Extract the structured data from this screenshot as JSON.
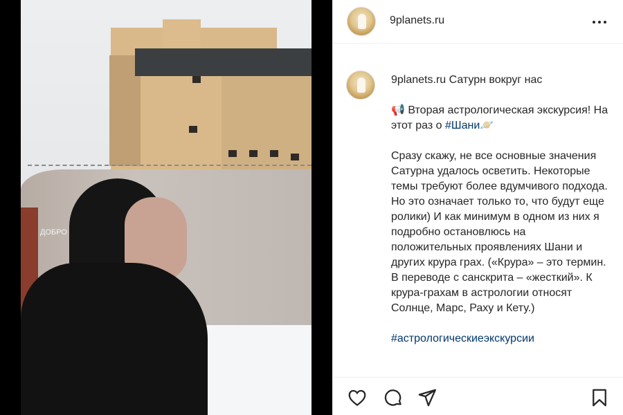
{
  "post": {
    "username": "9planets.ru",
    "video_graffiti": "ДОБРО"
  },
  "caption": {
    "username": "9planets.ru",
    "title": "Сатурн вокруг нас",
    "intro_icon": "📢",
    "intro": "Вторая астрологическая экскурсия! На этот раз о",
    "intro_hashtag": "#Шани",
    "intro_end": "🪐",
    "body": "Сразу скажу, не все основные значения Сатурна удалось осветить. Некоторые темы требуют более вдумчивого подхода. Но это означает только то, что будут еще ролики) И как минимум в одном из них я подробно остановлюсь на положительных проявлениях Шани и других крура грах. («Крура» – это термин. В переводе с санскрита – «жесткий». К крура-грахам в астрологии относят Солнце, Марс, Раху и Кету.)",
    "hashtag": "#астрологическиеэкскурсии"
  },
  "icons": {
    "more": "more-options-icon",
    "like": "heart-icon",
    "comment": "comment-icon",
    "share": "send-icon",
    "save": "bookmark-icon"
  },
  "colors": {
    "text": "#262626",
    "hashtag": "#00376b",
    "border": "#efefef"
  }
}
